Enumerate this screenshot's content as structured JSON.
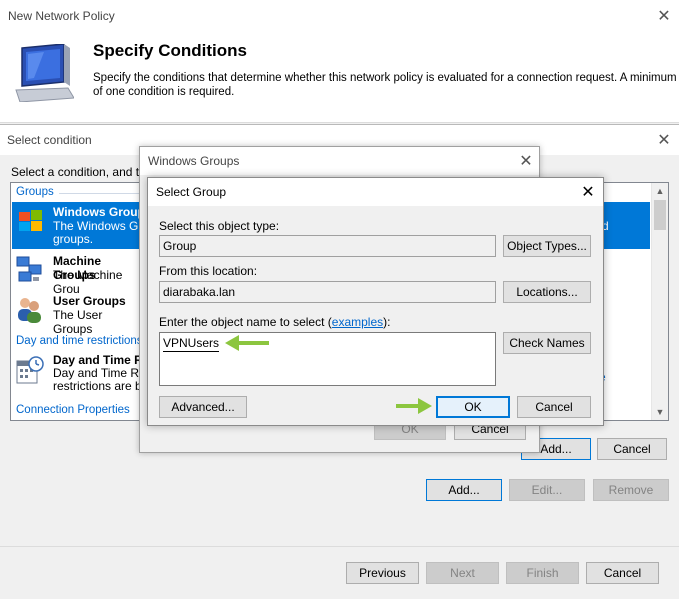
{
  "wizard": {
    "window_title": "New Network Policy",
    "heading": "Specify Conditions",
    "description": "Specify the conditions that determine whether this network policy is evaluated for a connection request. A minimum of one condition is required.",
    "buttons": {
      "add": "Add...",
      "edit": "Edit...",
      "remove": "Remove",
      "previous": "Previous",
      "next": "Next",
      "finish": "Finish",
      "cancel": "Cancel"
    }
  },
  "select_condition": {
    "title": "Select condition",
    "instruction": "Select a condition, and ther",
    "groups_header": "Groups",
    "items": [
      {
        "name": "Windows Groups",
        "desc1": "The Windows Gro",
        "desc2": "groups.",
        "right": "d"
      },
      {
        "name": "Machine Groups",
        "desc1": "The Machine Grou"
      },
      {
        "name": "User Groups",
        "desc1": "The User Groups"
      }
    ],
    "day_time_header": "Day and time restrictions",
    "day_time_item": {
      "name": "Day and Time R",
      "desc1": "Day and Time Re",
      "desc2": "restrictions are ba",
      "right": "e"
    },
    "connection_header": "Connection Properties",
    "buttons": {
      "add": "Add...",
      "cancel": "Cancel"
    }
  },
  "windows_groups": {
    "title": "Windows Groups",
    "buttons": {
      "ok": "OK",
      "cancel": "Cancel"
    }
  },
  "select_group": {
    "title": "Select Group",
    "object_type_label": "Select this object type:",
    "object_type_value": "Group",
    "object_types_button": "Object Types...",
    "location_label": "From this location:",
    "location_value": "diarabaka.lan",
    "locations_button": "Locations...",
    "enter_label_prefix": "Enter the object name to select (",
    "examples_link": "examples",
    "enter_label_suffix": "):",
    "object_name_value": "VPNUsers",
    "check_names_button": "Check Names",
    "advanced_button": "Advanced...",
    "ok_button": "OK",
    "cancel_button": "Cancel"
  },
  "colors": {
    "accent": "#0078d7",
    "arrow": "#8cc63f",
    "selection": "#0078d7",
    "link": "#0066cc"
  }
}
